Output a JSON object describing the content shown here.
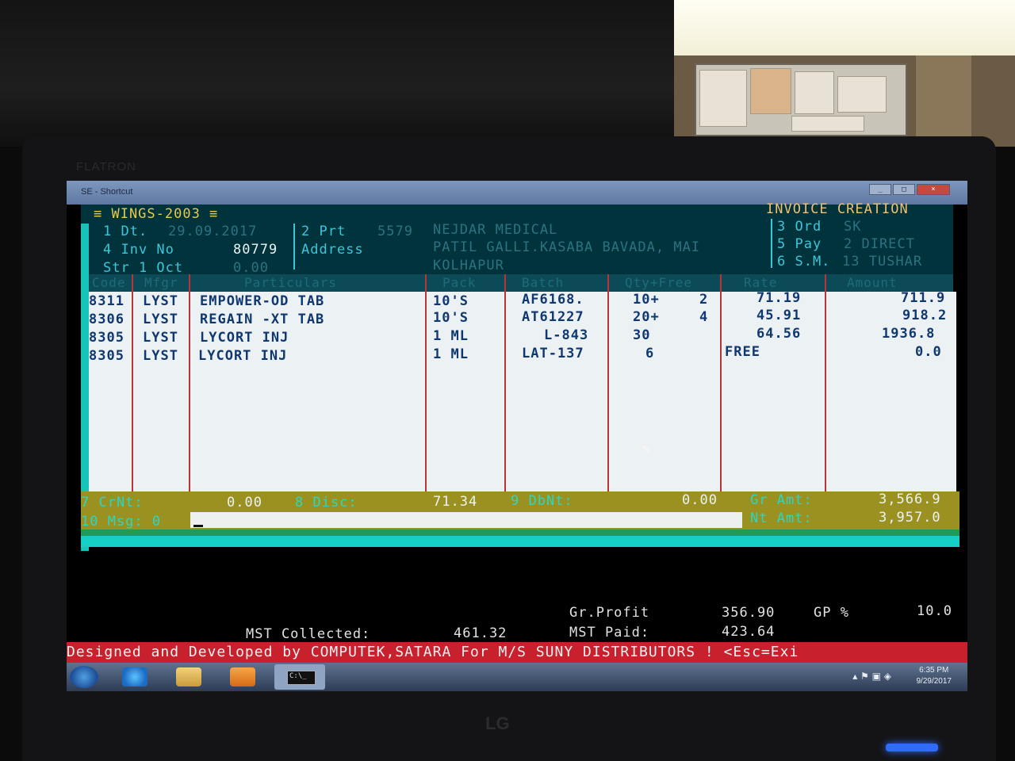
{
  "window": {
    "app_title": "SE - Shortcut",
    "menu_title": "≡ WINGS-2003 ≡",
    "mode_title": "INVOICE CREATION",
    "buttons": [
      "_",
      "□",
      "×"
    ]
  },
  "header": {
    "date_label": "1 Dt.",
    "date_value": "29.09.2017",
    "inv_label": "4 Inv No",
    "inv_value": "80779",
    "str_label": "Str 1  Oct",
    "str_value": "0.00",
    "party_label": "2 Prt",
    "party_code": "5579",
    "party_name": "NEJDAR MEDICAL",
    "address_label": "Address",
    "address_line1": "PATIL GALLI.KASABA BAVADA, MAI",
    "address_line2": "KOLHAPUR",
    "order_label": "3 Ord",
    "order_value": "SK",
    "pay_label": "5 Pay",
    "pay_value": "2 DIRECT",
    "sm_label": "6 S.M.",
    "sm_value": "13 TUSHAR"
  },
  "table": {
    "columns": [
      "Code",
      "Mfgr",
      "Particulars",
      "Pack",
      "Batch",
      "Qty+Free",
      "Rate",
      "Amount"
    ],
    "rows": [
      {
        "code": "8311",
        "mfgr": "LYST",
        "particulars": "EMPOWER-OD TAB",
        "pack": "10'S",
        "batch": "AF6168.",
        "qty": "10+",
        "free": "2",
        "rate": "71.19",
        "amount": "711.9"
      },
      {
        "code": "8306",
        "mfgr": "LYST",
        "particulars": "REGAIN -XT TAB",
        "pack": "10'S",
        "batch": "AT61227",
        "qty": "20+",
        "free": "4",
        "rate": "45.91",
        "amount": "918.2"
      },
      {
        "code": "8305",
        "mfgr": "LYST",
        "particulars": "LYCORT INJ",
        "pack": "1 ML",
        "batch": "L-843",
        "qty": "30",
        "free": "",
        "rate": "64.56",
        "amount": "1936.8"
      },
      {
        "code": "8305",
        "mfgr": "LYST",
        "particulars": "LYCORT INJ",
        "pack": "1 ML",
        "batch": "LAT-137",
        "qty": "6",
        "free": "",
        "rate": "FREE",
        "amount": "0.0"
      }
    ]
  },
  "totals": {
    "crnt_label": "7 CrNt:",
    "crnt_value": "0.00",
    "disc_label": "8 Disc:",
    "disc_value": "71.34",
    "dbnt_label": "9 DbNt:",
    "dbnt_value": "0.00",
    "gr_amt_label": "Gr Amt:",
    "gr_amt_value": "3,566.9",
    "msg_label": "10 Msg: 0",
    "nt_amt_label": "Nt Amt:",
    "nt_amt_value": "3,957.0"
  },
  "summary": {
    "gr_profit_label": "Gr.Profit",
    "gr_profit_value": "356.90",
    "gp_label": "GP %",
    "gp_value": "10.0",
    "mst_collected_label": "MST Collected:",
    "mst_collected_value": "461.32",
    "mst_paid_label": "MST Paid:",
    "mst_paid_value": "423.64"
  },
  "status_line": "Designed and Developed by COMPUTEK,SATARA For M/S SUNY DISTRIBUTORS ! <Esc=Exi",
  "taskbar": {
    "time": "6:35 PM",
    "date": "9/29/2017",
    "cmd_label": "C:\\_"
  },
  "monitor": {
    "model": "FLATRON",
    "brand": "LG"
  }
}
